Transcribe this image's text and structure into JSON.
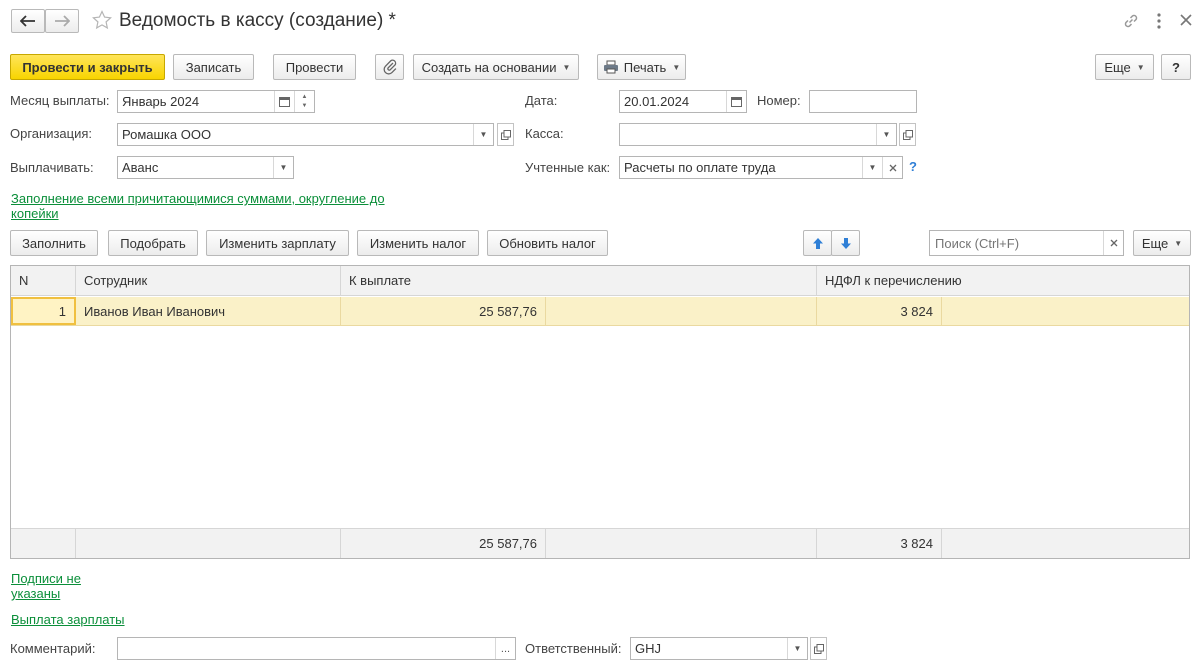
{
  "titlebar": {
    "title": "Ведомость в кассу (создание) *"
  },
  "toolbar": {
    "post_close": "Провести и закрыть",
    "save": "Записать",
    "post": "Провести",
    "create_based": "Создать на основании",
    "print": "Печать",
    "more": "Еще",
    "help": "?"
  },
  "form": {
    "month_label": "Месяц выплаты:",
    "month_value": "Январь 2024",
    "date_label": "Дата:",
    "date_value": "20.01.2024",
    "number_label": "Номер:",
    "number_value": "",
    "org_label": "Организация:",
    "org_value": "Ромашка ООО",
    "cash_label": "Касса:",
    "cash_value": "",
    "pay_label": "Выплачивать:",
    "pay_value": "Аванс",
    "account_label": "Учтенные как:",
    "account_value": "Расчеты по оплате труда",
    "account_help": "?",
    "fill_link_line1": "Заполнение всеми причитающимися суммами, округление до",
    "fill_link_line2": "копейки"
  },
  "table_toolbar": {
    "fill": "Заполнить",
    "pick": "Подобрать",
    "change_salary": "Изменить зарплату",
    "change_tax": "Изменить налог",
    "update_tax": "Обновить налог",
    "search_placeholder": "Поиск (Ctrl+F)",
    "more": "Еще"
  },
  "table": {
    "columns": [
      "N",
      "Сотрудник",
      "К выплате",
      "НДФЛ к перечислению"
    ],
    "rows": [
      {
        "n": "1",
        "employee": "Иванов Иван Иванович",
        "to_pay": "25 587,76",
        "ndfl": "3 824"
      }
    ],
    "totals": {
      "to_pay": "25 587,76",
      "ndfl": "3 824"
    }
  },
  "footer": {
    "signatures_line1": "Подписи не",
    "signatures_line2": "указаны",
    "salary_payment": "Выплата зарплаты",
    "comment_label": "Комментарий:",
    "comment_value": "",
    "responsible_label": "Ответственный:",
    "responsible_value": "GHJ"
  },
  "colors": {
    "primary_button": "#f8d400",
    "link_green": "#0b8f3a",
    "selected_row": "#faf1c8",
    "arrow_blue": "#2f7fd6"
  },
  "icons": [
    "back-arrow-icon",
    "forward-arrow-icon",
    "star-icon",
    "link-icon",
    "more-vert-icon",
    "close-icon",
    "paperclip-icon",
    "printer-icon",
    "calendar-icon",
    "arrow-up-icon",
    "arrow-down-icon",
    "clear-icon",
    "open-icon",
    "dropdown-icon"
  ]
}
